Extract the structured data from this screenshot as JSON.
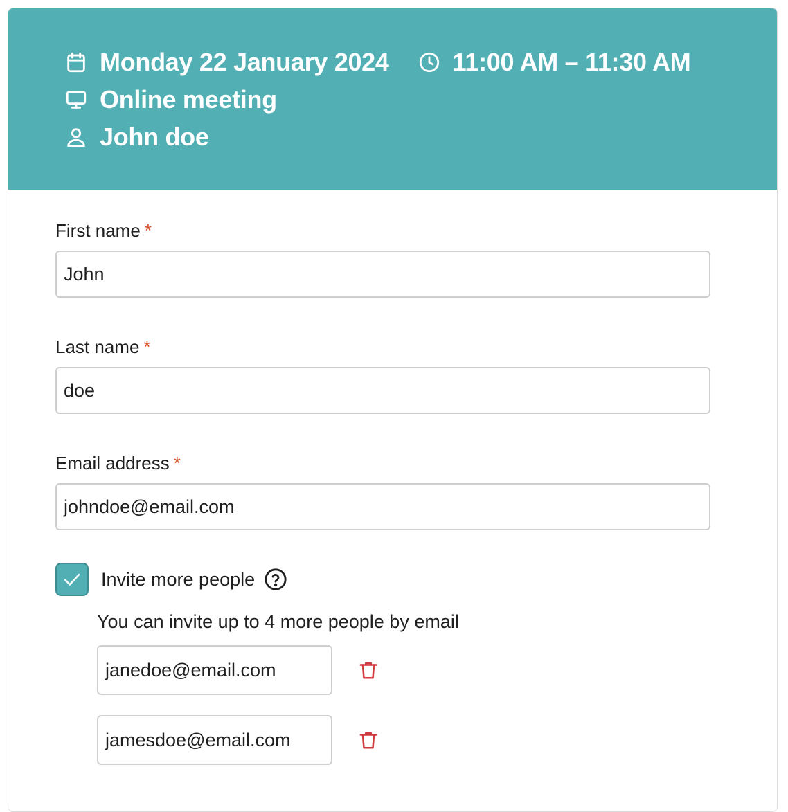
{
  "booking": {
    "date": "Monday 22 January 2024",
    "time": "11:00 AM – 11:30 AM",
    "location": "Online meeting",
    "host": "John doe",
    "icons": {
      "date": "calendar-icon",
      "time": "clock-icon",
      "location": "monitor-icon",
      "host": "user-icon"
    }
  },
  "form": {
    "required_marker": "*",
    "first_name": {
      "label": "First name",
      "value": "John"
    },
    "last_name": {
      "label": "Last name",
      "value": "doe"
    },
    "email": {
      "label": "Email address",
      "value": "johndoe@email.com"
    },
    "invite": {
      "label": "Invite more people",
      "checked": true,
      "help_icon": "question-circle-icon",
      "hint": "You can invite up to 4 more people by email",
      "guests": [
        {
          "value": "janedoe@email.com",
          "remove_icon": "trash-icon"
        },
        {
          "value": "jamesdoe@email.com",
          "remove_icon": "trash-icon"
        }
      ]
    }
  },
  "colors": {
    "accent": "#52afb3",
    "required": "#d9542c",
    "danger": "#d0393e",
    "border": "#cfcfcf"
  }
}
